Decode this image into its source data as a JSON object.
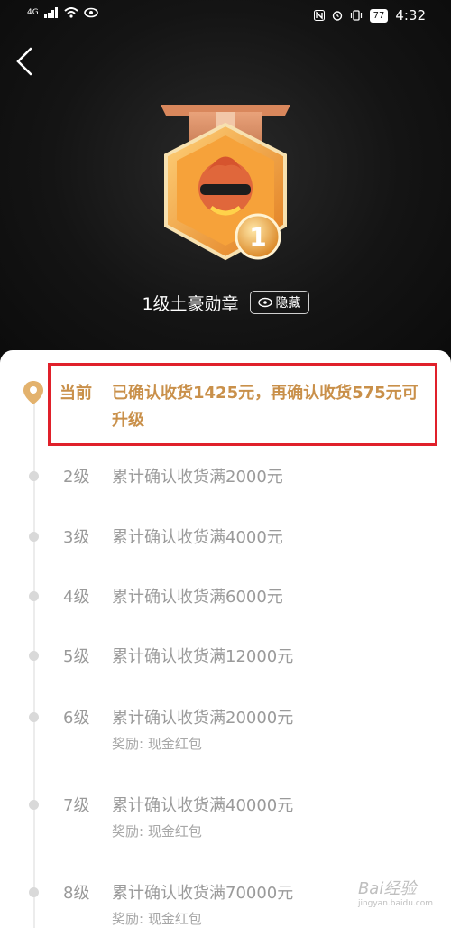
{
  "status_bar": {
    "network": "4G",
    "battery": "77",
    "time": "4:32"
  },
  "header": {
    "back_icon": "chevron-left-icon"
  },
  "medal": {
    "title": "1级土豪勋章",
    "level_number": "1",
    "hide_button_label": "隐藏"
  },
  "current": {
    "label": "当前",
    "text": "已确认收货1425元，再确认收货575元可升级"
  },
  "levels": [
    {
      "level": "2级",
      "requirement": "累计确认收货满2000元",
      "reward": ""
    },
    {
      "level": "3级",
      "requirement": "累计确认收货满4000元",
      "reward": ""
    },
    {
      "level": "4级",
      "requirement": "累计确认收货满6000元",
      "reward": ""
    },
    {
      "level": "5级",
      "requirement": "累计确认收货满12000元",
      "reward": ""
    },
    {
      "level": "6级",
      "requirement": "累计确认收货满20000元",
      "reward": "奖励:  现金红包"
    },
    {
      "level": "7级",
      "requirement": "累计确认收货满40000元",
      "reward": "奖励:  现金红包"
    },
    {
      "level": "8级",
      "requirement": "累计确认收货满70000元",
      "reward": "奖励:  现金红包"
    }
  ],
  "watermark": {
    "brand": "Bai经验",
    "url": "jingyan.baidu.com"
  },
  "colors": {
    "accent_gold": "#c9904a",
    "highlight_red": "#e0202a",
    "muted_text": "#9a9a9a"
  }
}
